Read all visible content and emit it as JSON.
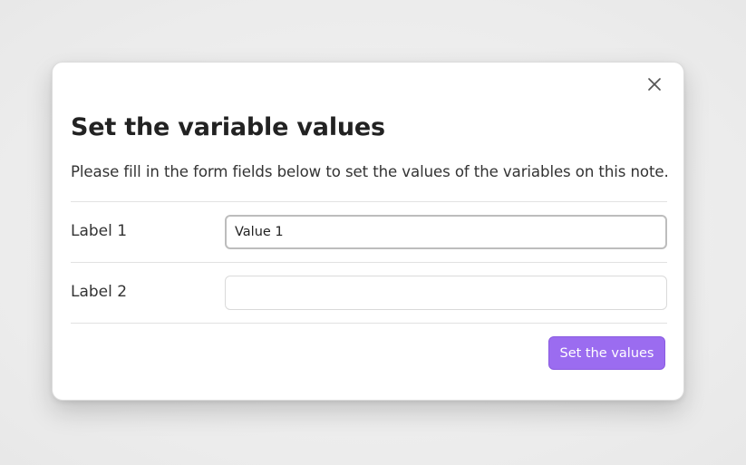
{
  "modal": {
    "title": "Set the variable values",
    "description": "Please fill in the form fields below to set the values of the variables on this note.",
    "close_icon": "close-icon",
    "fields": [
      {
        "label": "Label 1",
        "value": "Value 1",
        "placeholder": "",
        "focused": true
      },
      {
        "label": "Label 2",
        "value": "",
        "placeholder": "",
        "focused": false
      }
    ],
    "submit_label": "Set the values",
    "colors": {
      "accent": "#9b6cf0",
      "accent_text": "#ffffff",
      "title_text": "#222222"
    }
  }
}
